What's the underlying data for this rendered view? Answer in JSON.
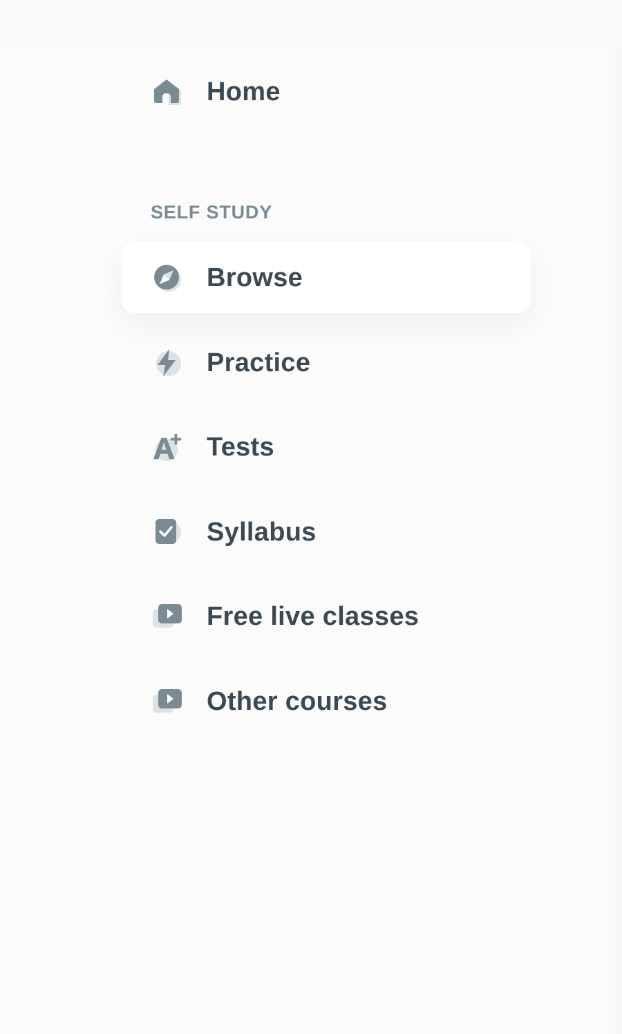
{
  "nav": {
    "home": {
      "label": "Home",
      "icon": "home-icon"
    },
    "section_heading": "SELF STUDY",
    "items": [
      {
        "label": "Browse",
        "icon": "compass-icon",
        "active": true
      },
      {
        "label": "Practice",
        "icon": "lightning-icon",
        "active": false
      },
      {
        "label": "Tests",
        "icon": "grade-a-plus-icon",
        "active": false
      },
      {
        "label": "Syllabus",
        "icon": "checklist-icon",
        "active": false
      },
      {
        "label": "Free live classes",
        "icon": "video-play-icon",
        "active": false
      },
      {
        "label": "Other courses",
        "icon": "video-play-icon",
        "active": false
      }
    ]
  },
  "colors": {
    "text": "#3c4852",
    "heading": "#7a8b94",
    "icon_dark": "#7a8b94",
    "icon_light": "#dde2e5",
    "active_bg": "#ffffff",
    "page_bg": "#fbfbfc"
  }
}
